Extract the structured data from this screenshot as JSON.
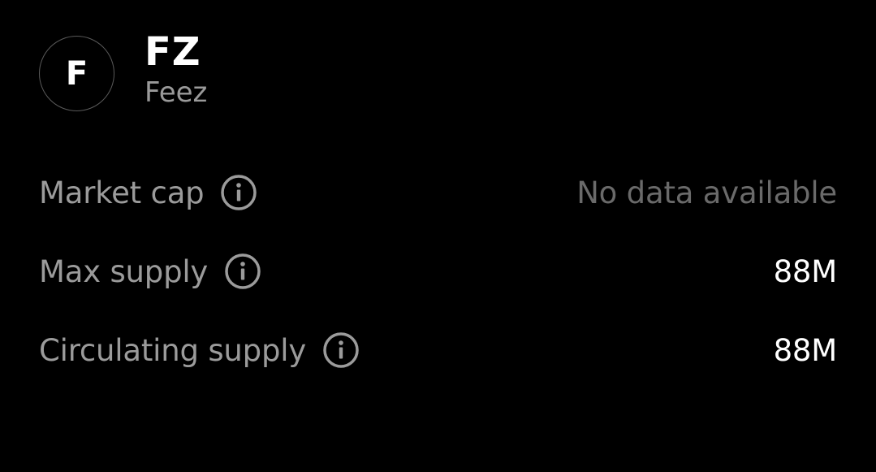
{
  "token": {
    "avatar_letter": "F",
    "symbol": "FZ",
    "name": "Feez"
  },
  "stats": [
    {
      "label": "Market cap",
      "value": "No data available",
      "icon": "info-icon"
    },
    {
      "label": "Max supply",
      "value": "88M",
      "icon": "info-icon"
    },
    {
      "label": "Circulating supply",
      "value": "88M",
      "icon": "info-icon"
    }
  ],
  "colors": {
    "background": "#000000",
    "primary_text": "#ffffff",
    "secondary_text": "#9b9b9b",
    "muted_text": "#6a6a6a",
    "avatar_border": "#5a5a5a"
  }
}
